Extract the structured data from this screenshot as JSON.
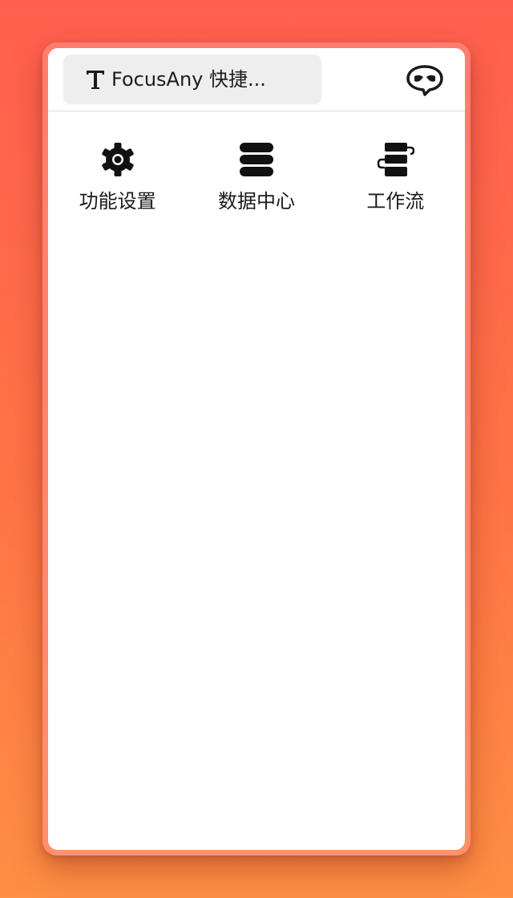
{
  "header": {
    "search_title": "FocusAny 快捷...",
    "search_icon": "text-t-icon",
    "bot_icon": "chat-bot-icon"
  },
  "features": [
    {
      "label": "功能设置",
      "icon": "gear-icon"
    },
    {
      "label": "数据中心",
      "icon": "database-icon"
    },
    {
      "label": "工作流",
      "icon": "workflow-icon"
    }
  ],
  "colors": {
    "background_top": "#ff5f4f",
    "background_bottom": "#ff8f44",
    "search_bg": "#eeeeee",
    "text": "#1a1a1a"
  }
}
